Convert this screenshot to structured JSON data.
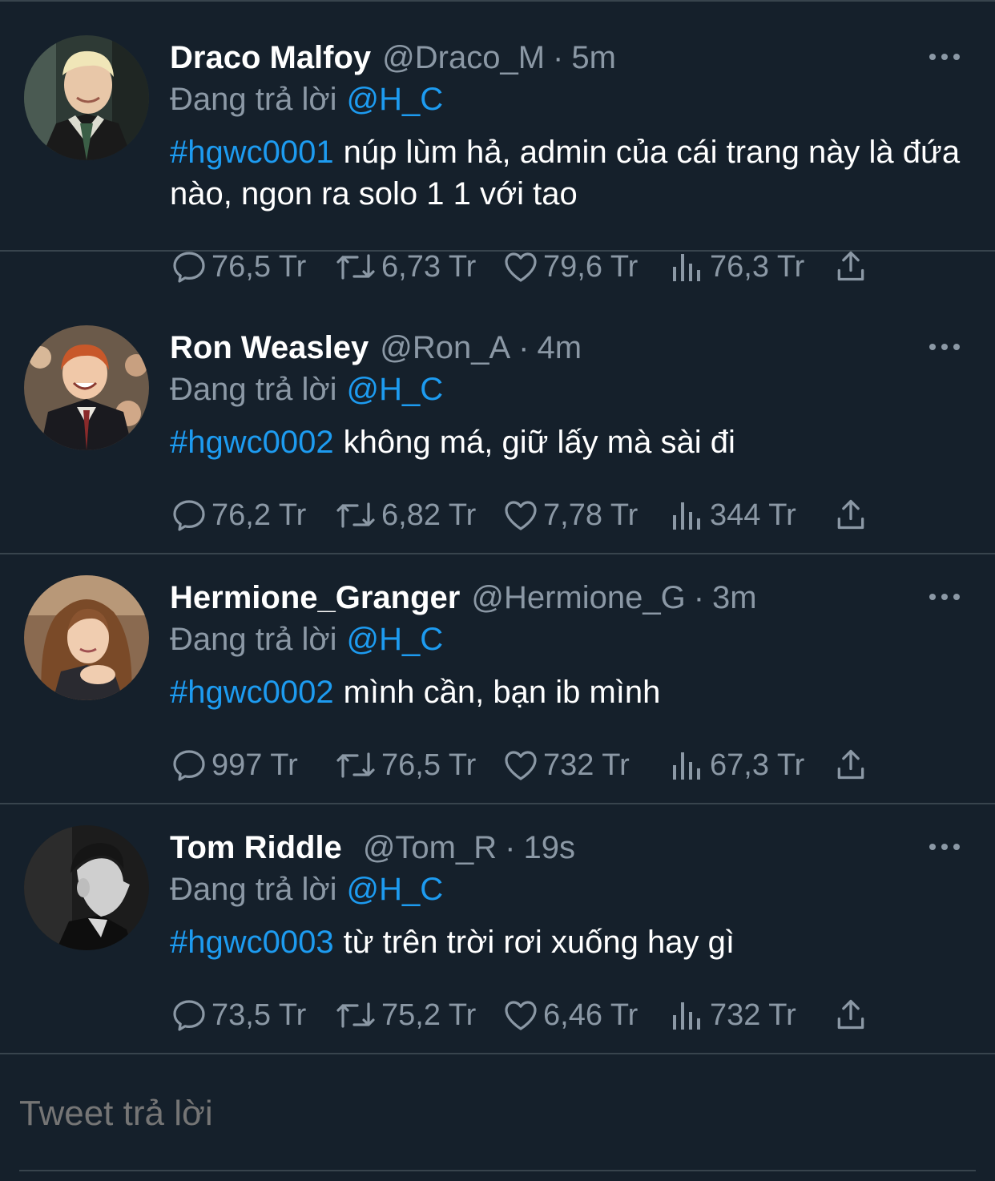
{
  "colors": {
    "background": "#15202b",
    "accent": "#1d9bf0",
    "muted": "#8b98a5",
    "divider": "#38444d"
  },
  "reply_prefix": "Đang trả lời",
  "tweets": [
    {
      "name": "Draco Malfoy",
      "handle": "@Draco_M",
      "time": "5m",
      "reply_to": "@H_C",
      "hashtag": "#hgwc0001",
      "text": "núp lùm hả, admin của cái trang này là đứa nào, ngon ra solo 1 1 với tao",
      "replies": "76,5 Tr",
      "retweets": "6,73 Tr",
      "likes": "79,6 Tr",
      "views": "76,3 Tr",
      "avatar_icon": "draco-avatar"
    },
    {
      "name": "Ron Weasley",
      "handle": "@Ron_A",
      "time": "4m",
      "reply_to": "@H_C",
      "hashtag": "#hgwc0002",
      "text": "không má, giữ lấy mà sài đi",
      "replies": "76,2 Tr",
      "retweets": "6,82 Tr",
      "likes": "7,78 Tr",
      "views": "344 Tr",
      "avatar_icon": "ron-avatar"
    },
    {
      "name": "Hermione_Granger",
      "handle": "@Hermione_G",
      "time": "3m",
      "reply_to": "@H_C",
      "hashtag": "#hgwc0002",
      "text": "mình cần, bạn ib mình",
      "replies": "997 Tr",
      "retweets": "76,5 Tr",
      "likes": "732 Tr",
      "views": "67,3 Tr",
      "avatar_icon": "hermione-avatar"
    },
    {
      "name": "Tom Riddle",
      "handle": "@Tom_R",
      "time": "19s",
      "reply_to": "@H_C",
      "hashtag": "#hgwc0003",
      "text": "từ trên trời rơi xuống hay gì",
      "replies": "73,5 Tr",
      "retweets": "75,2 Tr",
      "likes": "6,46 Tr",
      "views": "732 Tr",
      "avatar_icon": "tom-avatar"
    }
  ],
  "compose": {
    "placeholder": "Tweet trả lời"
  }
}
